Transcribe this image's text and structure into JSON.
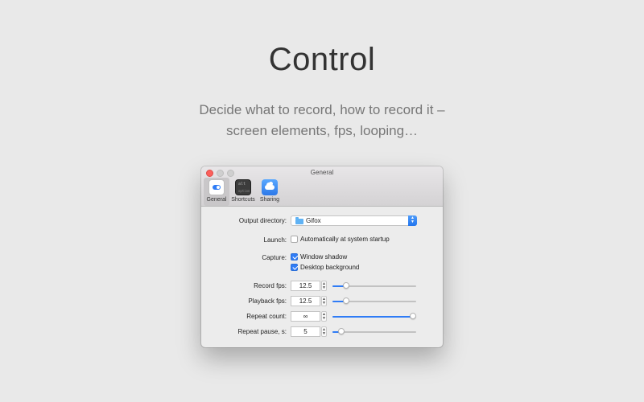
{
  "hero": {
    "title": "Control",
    "subtitle_line1": "Decide what to record, how to record it –",
    "subtitle_line2": "screen elements, fps, looping…"
  },
  "window": {
    "title": "General",
    "tabs": [
      {
        "label": "General",
        "icon": "toggle-switch-icon",
        "active": true
      },
      {
        "label": "Shortcuts",
        "icon": "keyboard-icon",
        "active": false
      },
      {
        "label": "Sharing",
        "icon": "cloud-icon",
        "active": false
      }
    ],
    "shortcuts_icon_text": {
      "line1": "alt",
      "line2": "option"
    }
  },
  "settings": {
    "output_directory": {
      "label": "Output directory:",
      "value": "Gifox"
    },
    "launch": {
      "label": "Launch:",
      "option": "Automatically at system startup",
      "checked": false
    },
    "capture": {
      "label": "Capture:",
      "options": [
        {
          "text": "Window shadow",
          "checked": true
        },
        {
          "text": "Desktop background",
          "checked": true
        }
      ]
    },
    "record_fps": {
      "label": "Record fps:",
      "value": "12.5",
      "slider_fraction": 0.14
    },
    "playback_fps": {
      "label": "Playback fps:",
      "value": "12.5",
      "slider_fraction": 0.14
    },
    "repeat_count": {
      "label": "Repeat count:",
      "value": "∞",
      "slider_fraction": 1.0
    },
    "repeat_pause": {
      "label": "Repeat pause, s:",
      "value": "5",
      "slider_fraction": 0.07
    }
  },
  "colors": {
    "accent": "#2f7cf6",
    "close_button": "#fc605c",
    "background": "#e9e9e9"
  }
}
